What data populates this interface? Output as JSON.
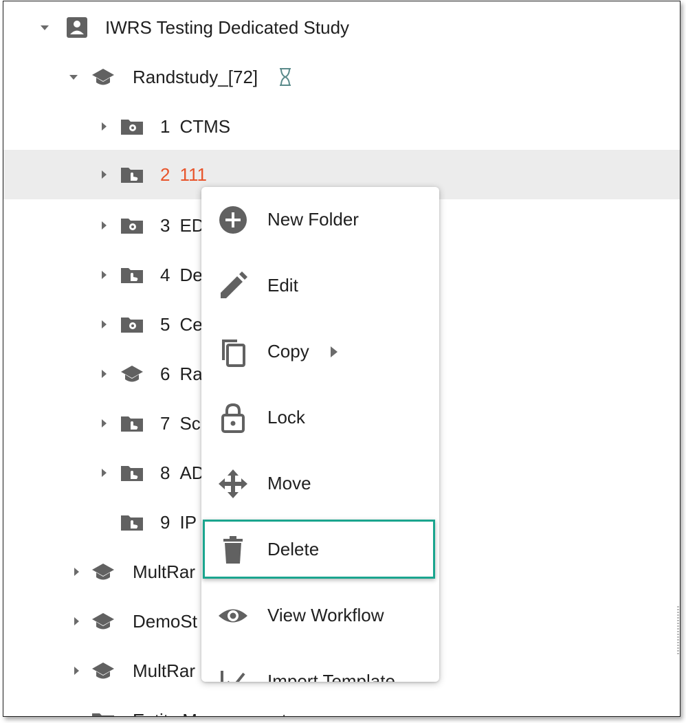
{
  "tree": {
    "root": {
      "label": "IWRS Testing Dedicated Study",
      "icon": "account-box-icon"
    },
    "study": {
      "label": "Randstudy_[72]",
      "icon": "school-icon",
      "status_icon": "hourglass-icon"
    },
    "folders": [
      {
        "num": "1",
        "name": "CTMS",
        "icon": "folder-gear-icon"
      },
      {
        "num": "2",
        "name": "111",
        "icon": "folder-hand-icon"
      },
      {
        "num": "3",
        "name": "ED",
        "icon": "folder-gear-icon"
      },
      {
        "num": "4",
        "name": "De",
        "icon": "folder-hand-icon"
      },
      {
        "num": "5",
        "name": "Ce",
        "icon": "folder-gear-icon"
      },
      {
        "num": "6",
        "name": "Ra",
        "icon": "school-icon"
      },
      {
        "num": "7",
        "name": "Sc",
        "icon": "folder-hand-icon"
      },
      {
        "num": "8",
        "name": "AD",
        "icon": "folder-hand-icon"
      },
      {
        "num": "9",
        "name": "IP",
        "icon": "folder-hand-icon"
      }
    ],
    "siblings": [
      {
        "label": "MultRar",
        "icon": "school-icon"
      },
      {
        "label": "DemoSt",
        "icon": "school-icon"
      },
      {
        "label": "MultRar",
        "icon": "school-icon"
      },
      {
        "label": "Entity Management",
        "icon": "folder-icon"
      }
    ]
  },
  "context_menu": {
    "items": [
      {
        "label": "New Folder",
        "icon": "add-circle-icon"
      },
      {
        "label": "Edit",
        "icon": "pencil-icon"
      },
      {
        "label": "Copy",
        "icon": "copy-icon",
        "submenu_icon": "chevron-right-icon"
      },
      {
        "label": "Lock",
        "icon": "lock-icon"
      },
      {
        "label": "Move",
        "icon": "move-icon"
      },
      {
        "label": "Delete",
        "icon": "trash-icon",
        "highlighted": true
      },
      {
        "label": "View Workflow",
        "icon": "eye-icon"
      },
      {
        "label": "Import Template",
        "icon": "import-icon"
      }
    ]
  },
  "colors": {
    "selected_text": "#e8542b",
    "highlight_border": "#1aa58e",
    "icon": "#616161"
  }
}
